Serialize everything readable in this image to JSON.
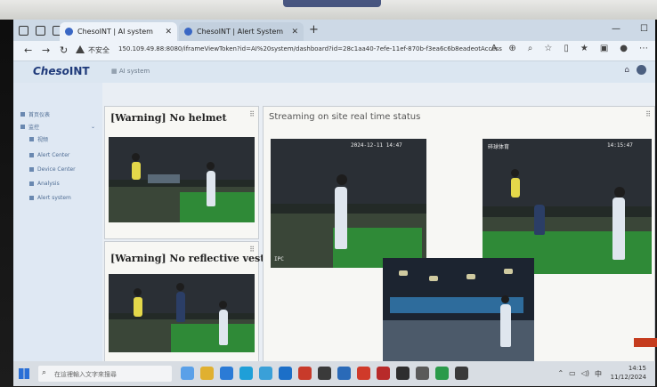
{
  "browser": {
    "tabs": [
      {
        "label": "ChesoINT | AI system",
        "active": true
      },
      {
        "label": "ChesoINT | Alert System",
        "active": false
      }
    ],
    "security_label": "不安全",
    "url": "150.109.49.88:8080/iframeViewToken?id=AI%20system/dashboard?id=28c1aa40-7efe-11ef-870b-f3ea6c6b8eadeotAccess"
  },
  "app": {
    "logo_prefix": "Cheso",
    "logo_suffix": "INT",
    "breadcrumb": "AI system"
  },
  "sidebar": {
    "items": [
      "首页仪表",
      "监控",
      "视频",
      "Alert Center",
      "Device Center",
      "Analysis",
      "Alert system"
    ]
  },
  "main": {
    "alert_cards": [
      {
        "title": "[Warning] No helmet"
      },
      {
        "title": "[Warning] No reflective vest"
      }
    ],
    "stream_title": "Streaming on site real time status",
    "cams": [
      {
        "osd_top": "2024-12-11 14:47",
        "osd_label": "IPC"
      },
      {
        "osd_top": "14:15:47",
        "osd_label": "碎球体育"
      },
      {
        "osd_top": "",
        "osd_label": ""
      }
    ]
  },
  "taskbar": {
    "search_placeholder": "在這裡輸入文字來搜尋",
    "time": "14:15",
    "date": "11/12/2024",
    "ime": "中"
  },
  "colors": {
    "accent": "#3a67c4",
    "sidebar_text": "#4f6d94",
    "warning_text": "#222222",
    "cctv_mat": "#2f8a37"
  }
}
